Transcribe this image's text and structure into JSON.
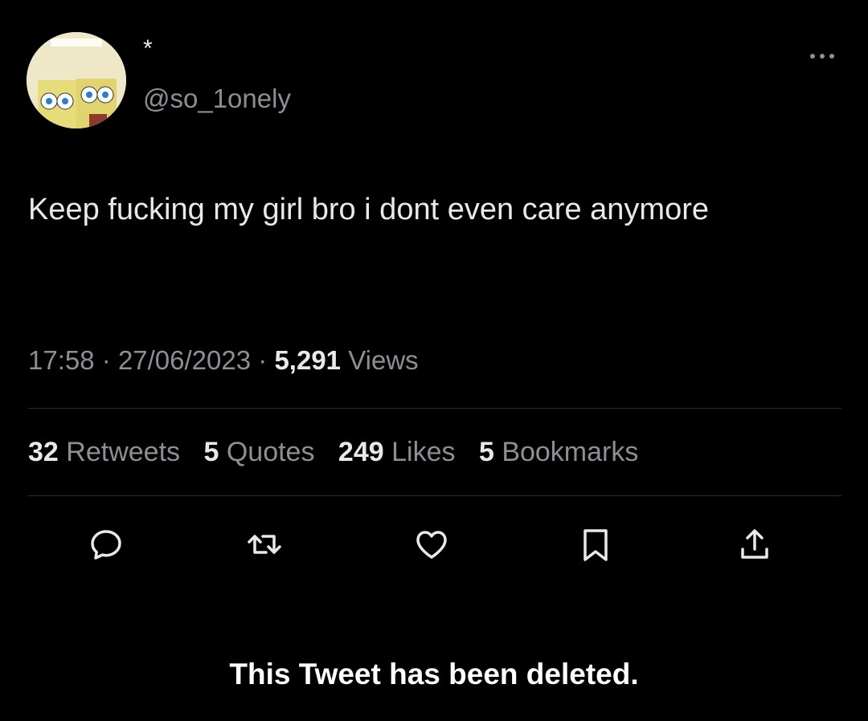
{
  "author": {
    "display_name": "*",
    "handle": "@so_1onely",
    "avatar_icon": "spongebob-avatar-icon"
  },
  "tweet": {
    "text": "Keep fucking my girl bro i dont even care anymore",
    "time": "17:58",
    "date": "27/06/2023",
    "views_count": "5,291",
    "views_label": "Views",
    "separator": "·"
  },
  "stats": [
    {
      "count": "32",
      "label": "Retweets"
    },
    {
      "count": "5",
      "label": "Quotes"
    },
    {
      "count": "249",
      "label": "Likes"
    },
    {
      "count": "5",
      "label": "Bookmarks"
    }
  ],
  "actions": [
    "reply-icon",
    "retweet-icon",
    "like-icon",
    "bookmark-icon",
    "share-icon"
  ],
  "notice": "This Tweet has been deleted.",
  "colors": {
    "background": "#000000",
    "primary_text": "#e7e9ea",
    "secondary_text": "#8b9095",
    "divider": "#2a2d30"
  }
}
